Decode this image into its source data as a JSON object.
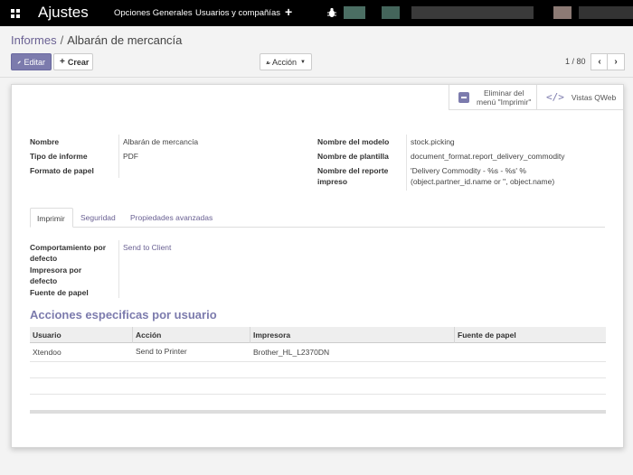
{
  "navbar": {
    "brand": "Ajustes",
    "menu": [
      "Opciones Generales",
      "Usuarios y compañías"
    ],
    "plus": "+"
  },
  "breadcrumb": {
    "parent": "Informes",
    "separator": "/",
    "current": "Albarán de mercancía"
  },
  "controls": {
    "edit": "Editar",
    "create": "Crear",
    "action": "Acción",
    "pager": "1 / 80"
  },
  "stat_buttons": {
    "unpublish_line1": "Eliminar del",
    "unpublish_line2": "menú \"Imprimir\"",
    "qweb": "Vistas QWeb"
  },
  "fields_left": [
    {
      "label": "Nombre",
      "value": "Albarán de mercancía"
    },
    {
      "label": "Tipo de informe",
      "value": "PDF"
    },
    {
      "label": "Formato de papel",
      "value": ""
    }
  ],
  "fields_right": [
    {
      "label": "Nombre del modelo",
      "value": "stock.picking"
    },
    {
      "label": "Nombre de plantilla",
      "value": "document_format.report_delivery_commodity"
    },
    {
      "label_line1": "Nombre del reporte",
      "label_line2": "impreso",
      "value_line1": "'Delivery Commodity - %s - %s' %",
      "value_line2": "(object.partner_id.name or '', object.name)"
    }
  ],
  "tabs": [
    "Imprimir",
    "Seguridad",
    "Propiedades avanzadas"
  ],
  "print_tab": {
    "behaviour_label_1": "Comportamiento por",
    "behaviour_label_2": "defecto",
    "behaviour_value": "Send to Client",
    "printer_label_1": "Impresora por",
    "printer_label_2": "defecto",
    "paper_source_label": "Fuente de papel"
  },
  "section_title": "Acciones especificas por usuario",
  "table": {
    "headers": [
      "Usuario",
      "Acción",
      "Impresora",
      "Fuente de papel"
    ],
    "rows": [
      [
        "Xtendoo",
        "Send to Printer",
        "Brother_HL_L2370DN",
        ""
      ]
    ]
  },
  "colors": {
    "primary": "#7c7bad",
    "link": "#6a6193",
    "navbar": "#000000"
  }
}
